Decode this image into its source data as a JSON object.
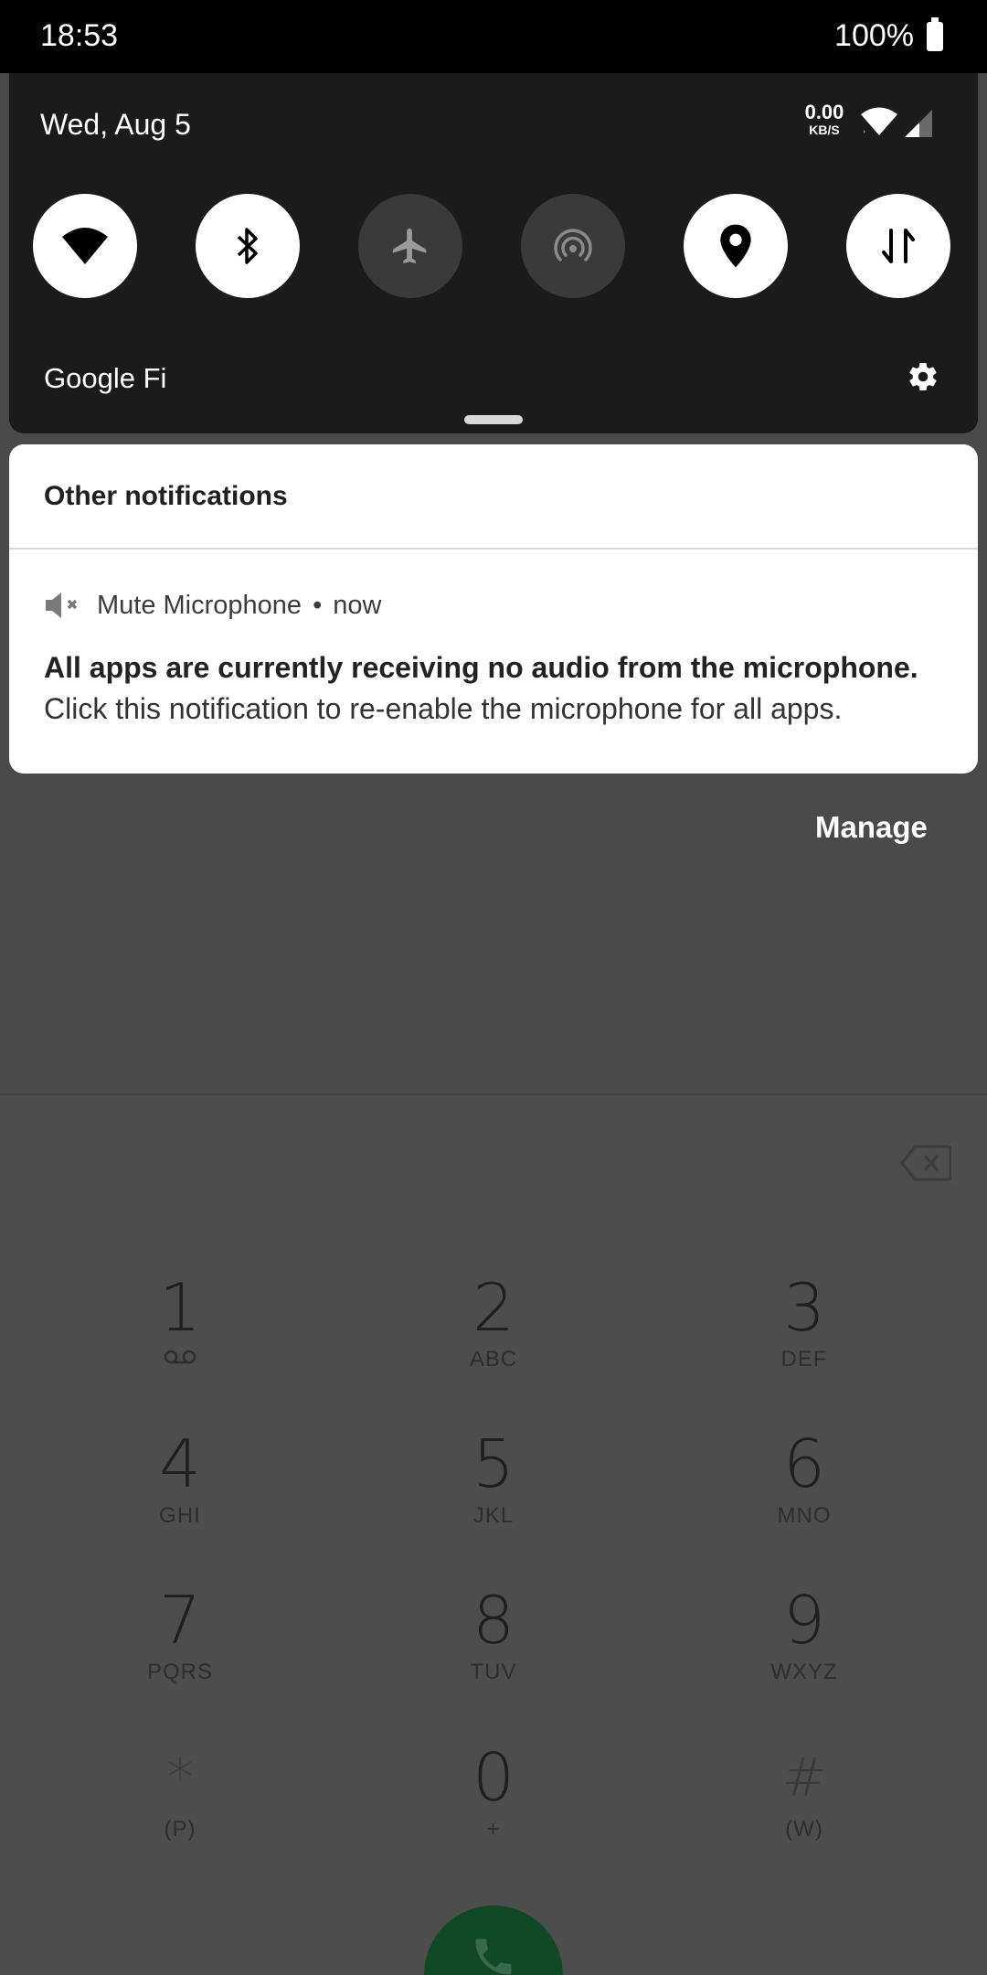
{
  "status_bar": {
    "time": "18:53",
    "battery_percent": "100%"
  },
  "quick_settings": {
    "date": "Wed, Aug 5",
    "net_speed_value": "0.00",
    "net_speed_unit": "KB/S",
    "carrier": "Google Fi",
    "tiles": [
      {
        "name": "wifi",
        "icon": "wifi-icon",
        "state": "on"
      },
      {
        "name": "bluetooth",
        "icon": "bluetooth-icon",
        "state": "on"
      },
      {
        "name": "airplane",
        "icon": "airplane-icon",
        "state": "off"
      },
      {
        "name": "hotspot",
        "icon": "hotspot-icon",
        "state": "off"
      },
      {
        "name": "location",
        "icon": "location-icon",
        "state": "on"
      },
      {
        "name": "mobile-data",
        "icon": "mobile-data-icon",
        "state": "on"
      }
    ]
  },
  "notification": {
    "section_title": "Other notifications",
    "app_icon": "mute-speaker-icon",
    "app_name": "Mute Microphone",
    "separator": "•",
    "time": "now",
    "title": "All apps are currently receiving no audio from the microphone.",
    "text": "Click this notification to re-enable the microphone for all apps."
  },
  "manage_label": "Manage",
  "dialer": {
    "keys": [
      {
        "digit": "1",
        "letters": ""
      },
      {
        "digit": "2",
        "letters": "ABC"
      },
      {
        "digit": "3",
        "letters": "DEF"
      },
      {
        "digit": "4",
        "letters": "GHI"
      },
      {
        "digit": "5",
        "letters": "JKL"
      },
      {
        "digit": "6",
        "letters": "MNO"
      },
      {
        "digit": "7",
        "letters": "PQRS"
      },
      {
        "digit": "8",
        "letters": "TUV"
      },
      {
        "digit": "9",
        "letters": "WXYZ"
      },
      {
        "digit": "*",
        "letters": "(P)"
      },
      {
        "digit": "0",
        "letters": "+"
      },
      {
        "digit": "#",
        "letters": "(W)"
      }
    ]
  },
  "colors": {
    "panel_bg": "#1b1b1b",
    "tile_on": "#ffffff",
    "tile_off": "#3a3a3a",
    "call_button": "#0f4a24"
  }
}
